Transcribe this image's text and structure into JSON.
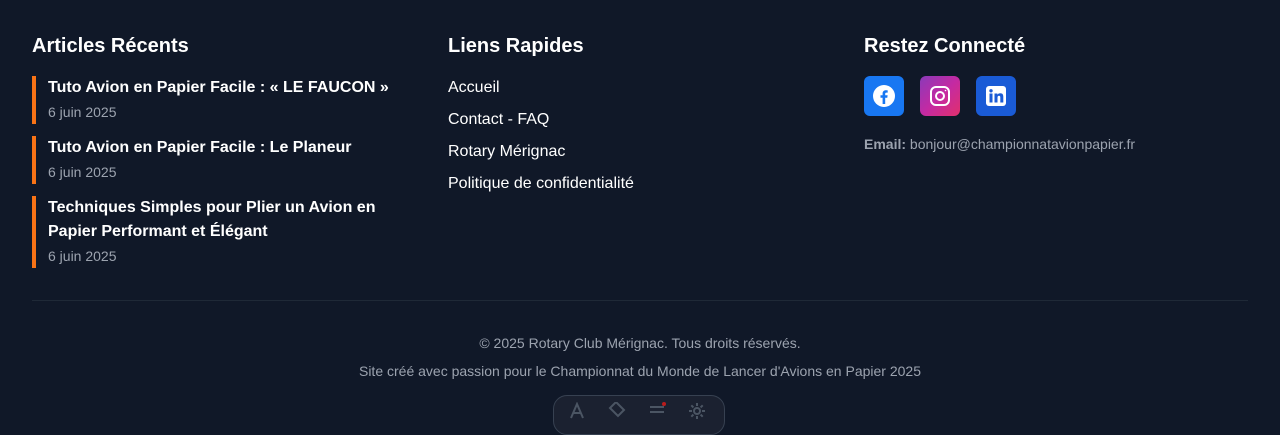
{
  "recent_articles": {
    "title": "Articles Récents",
    "items": [
      {
        "title": "Tuto Avion en Papier Facile : « LE FAUCON »",
        "date": "6 juin 2025"
      },
      {
        "title": "Tuto Avion en Papier Facile : Le Planeur",
        "date": "6 juin 2025"
      },
      {
        "title": "Techniques Simples pour Plier un Avion en Papier Performant et Élégant",
        "date": "6 juin 2025"
      }
    ]
  },
  "quick_links": {
    "title": "Liens Rapides",
    "items": [
      "Accueil",
      "Contact - FAQ",
      "Rotary Mérignac",
      "Politique de confidentialité"
    ]
  },
  "stay_connected": {
    "title": "Restez Connecté",
    "socials": [
      {
        "icon": "facebook-icon",
        "color": "#1877f2"
      },
      {
        "icon": "instagram-icon",
        "color": "#c32aa3"
      },
      {
        "icon": "linkedin-icon",
        "color": "#1a5bd6"
      }
    ],
    "email_label": "Email:",
    "email": "bonjour@championnatavionpapier.fr"
  },
  "copyright": "© 2025 Rotary Club Mérignac. Tous droits réservés.",
  "credit": "Site créé avec passion pour le Championnat du Monde de Lancer d'Avions en Papier 2025",
  "colors": {
    "background": "#101828",
    "accent": "#f97316",
    "muted": "#9ca3af"
  }
}
